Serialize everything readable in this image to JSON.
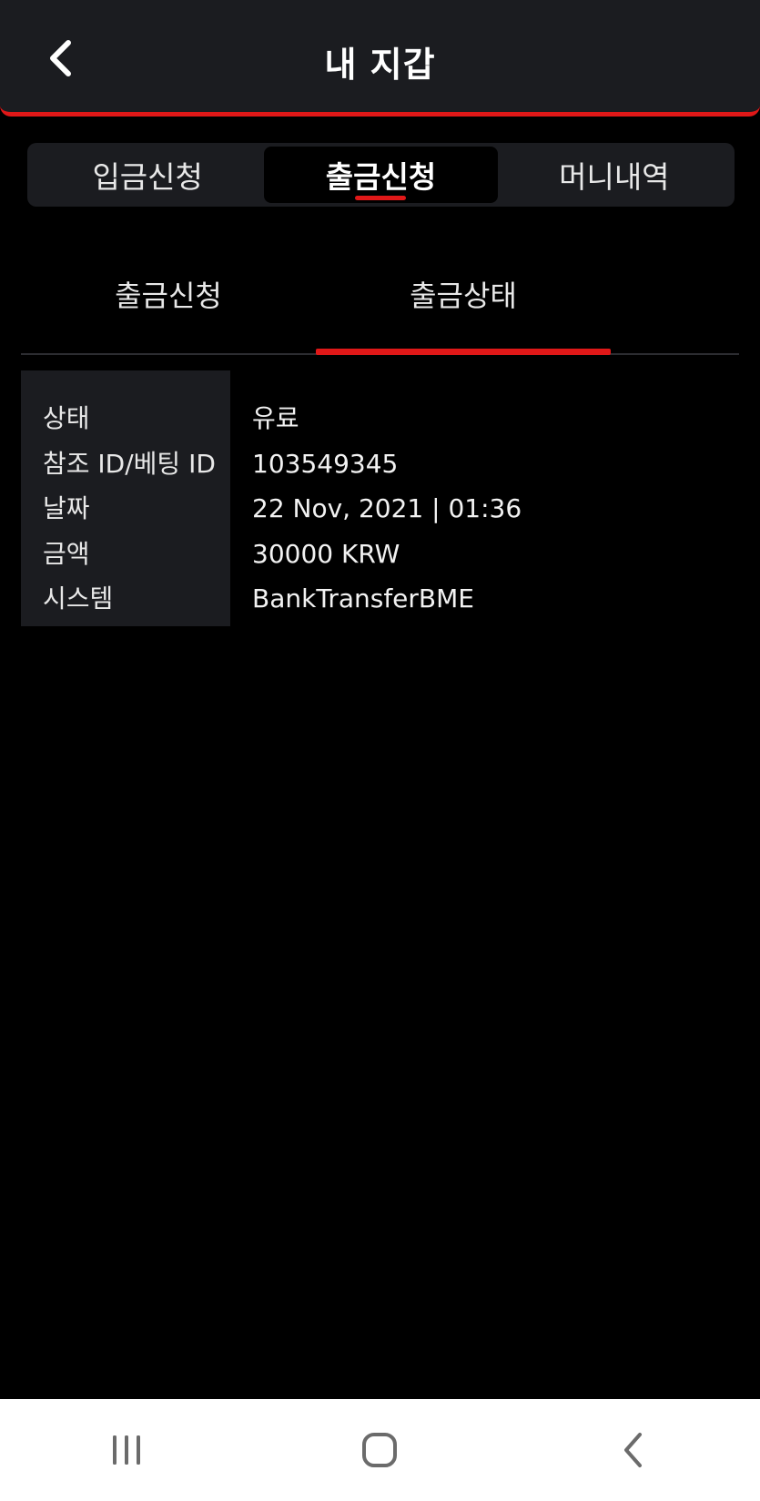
{
  "header": {
    "title": "내 지갑",
    "back_icon": "chevron-left-icon"
  },
  "main_tabs": [
    {
      "label": "입금신청",
      "active": false
    },
    {
      "label": "출금신청",
      "active": true
    },
    {
      "label": "머니내역",
      "active": false
    }
  ],
  "sub_tabs": [
    {
      "label": "출금신청",
      "active": false
    },
    {
      "label": "출금상태",
      "active": true
    }
  ],
  "details": {
    "rows": [
      {
        "label": "상태",
        "value": "유료"
      },
      {
        "label": "참조 ID/베팅 ID",
        "value": "103549345"
      },
      {
        "label": "날짜",
        "value": "22 Nov, 2021 | 01:36"
      },
      {
        "label": "금액",
        "value": "30000 KRW"
      },
      {
        "label": "시스템",
        "value": "BankTransferBME"
      }
    ]
  },
  "system_nav": {
    "recent_icon": "recent-apps-icon",
    "home_icon": "home-icon",
    "back_icon": "back-icon"
  },
  "colors": {
    "accent": "#e01818",
    "background": "#000000",
    "panel": "#1b1c20"
  }
}
